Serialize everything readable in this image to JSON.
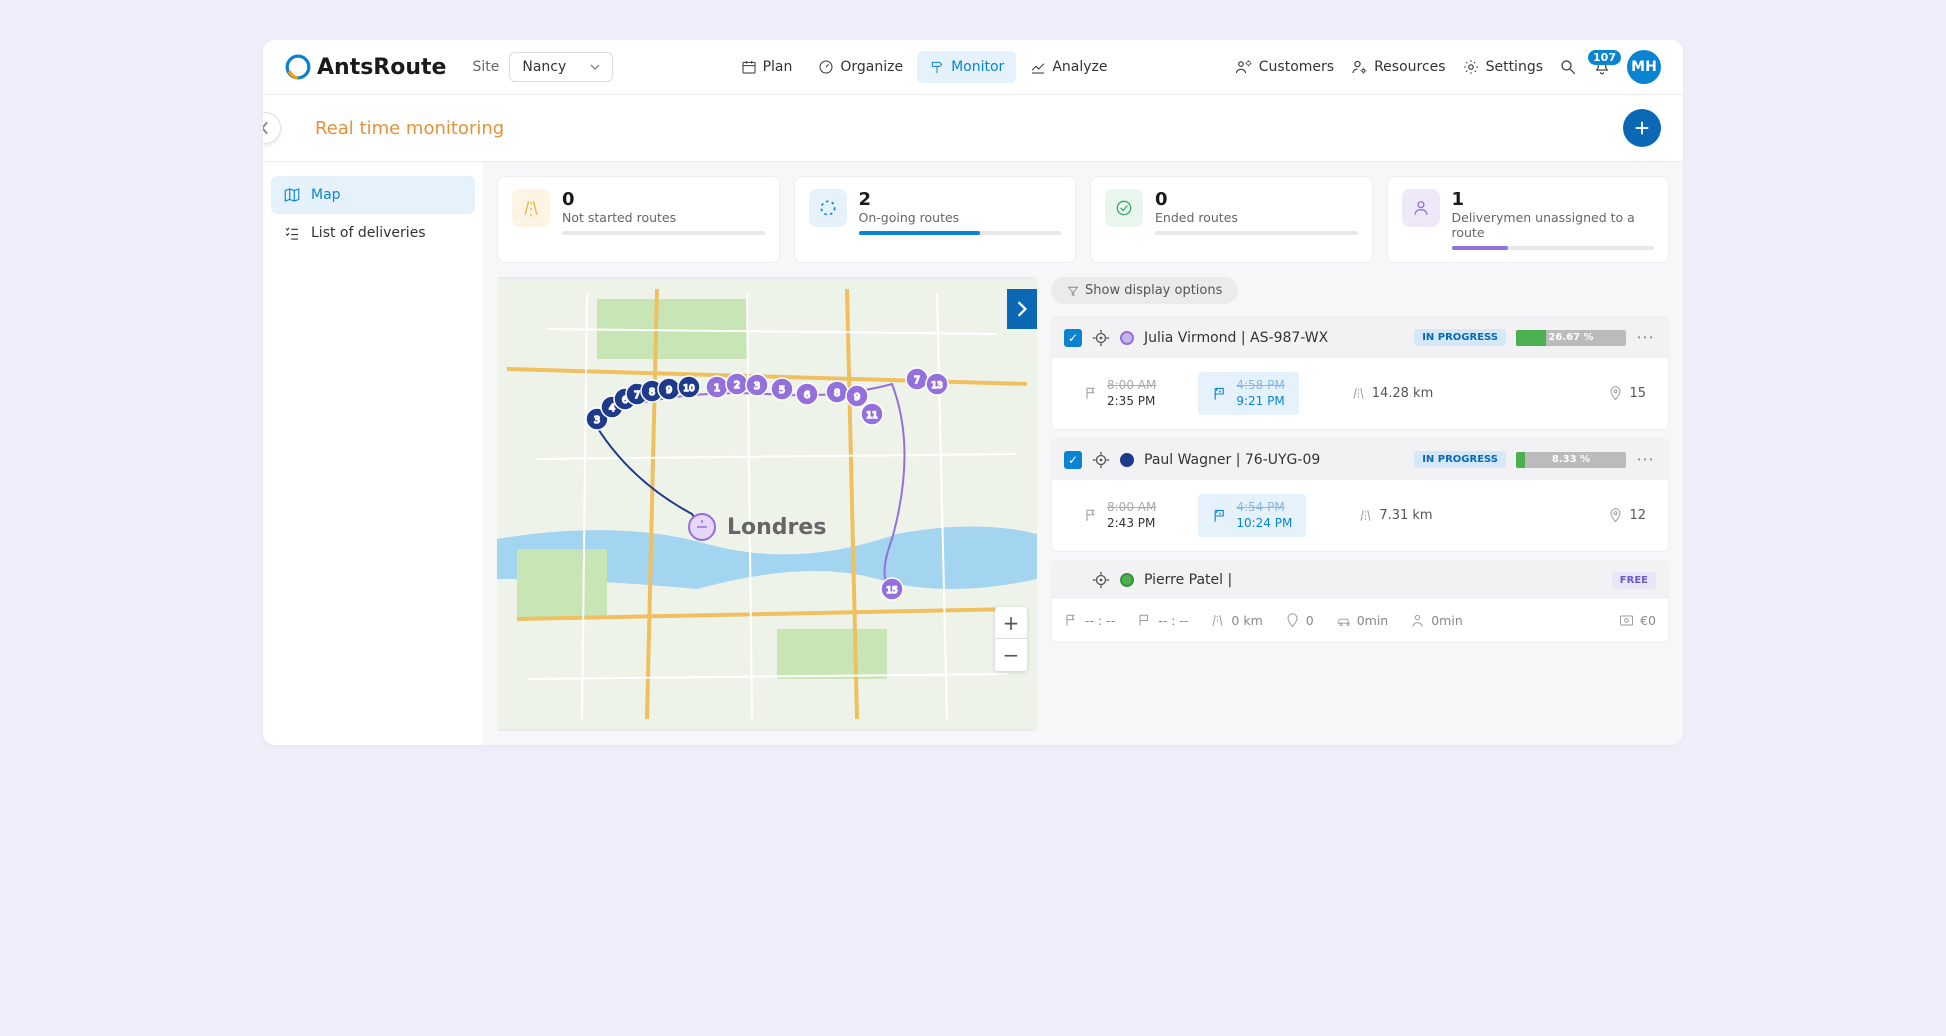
{
  "brand": "AntsRoute",
  "site": {
    "label": "Site",
    "value": "Nancy"
  },
  "nav": {
    "plan": "Plan",
    "organize": "Organize",
    "monitor": "Monitor",
    "analyze": "Analyze"
  },
  "tools": {
    "customers": "Customers",
    "resources": "Resources",
    "settings": "Settings"
  },
  "notifications": "107",
  "user_initials": "MH",
  "page_title": "Real time monitoring",
  "sidebar": {
    "map": "Map",
    "list": "List of deliveries"
  },
  "stats": {
    "not_started": {
      "value": "0",
      "label": "Not started routes"
    },
    "ongoing": {
      "value": "2",
      "label": "On-going routes"
    },
    "ended": {
      "value": "0",
      "label": "Ended routes"
    },
    "unassigned": {
      "value": "1",
      "label": "Deliverymen unassigned to a route"
    }
  },
  "filter_label": "Show display options",
  "map_city": "Londres",
  "routes": [
    {
      "driver": "Julia Virmond | AS-987-WX",
      "status": "IN PROGRESS",
      "color": "#9370db",
      "progress_pct": "26.67 %",
      "progress_width": "27%",
      "start_old": "8:00 AM",
      "start_new": "2:35 PM",
      "eta_old": "4:58 PM",
      "eta_new": "9:21 PM",
      "distance": "14.28 km",
      "stops": "15"
    },
    {
      "driver": "Paul Wagner | 76-UYG-09",
      "status": "IN PROGRESS",
      "color": "#1e3a8a",
      "progress_pct": "8.33 %",
      "progress_width": "8%",
      "start_old": "8:00 AM",
      "start_new": "2:43 PM",
      "eta_old": "4:54 PM",
      "eta_new": "10:24 PM",
      "distance": "7.31 km",
      "stops": "12"
    }
  ],
  "free_route": {
    "driver": "Pierre Patel |",
    "status": "FREE",
    "color": "#4caf50",
    "start": "-- : --",
    "end": "-- : --",
    "distance": "0 km",
    "stops": "0",
    "drive_time": "0min",
    "wait_time": "0min",
    "cost": "€0"
  }
}
